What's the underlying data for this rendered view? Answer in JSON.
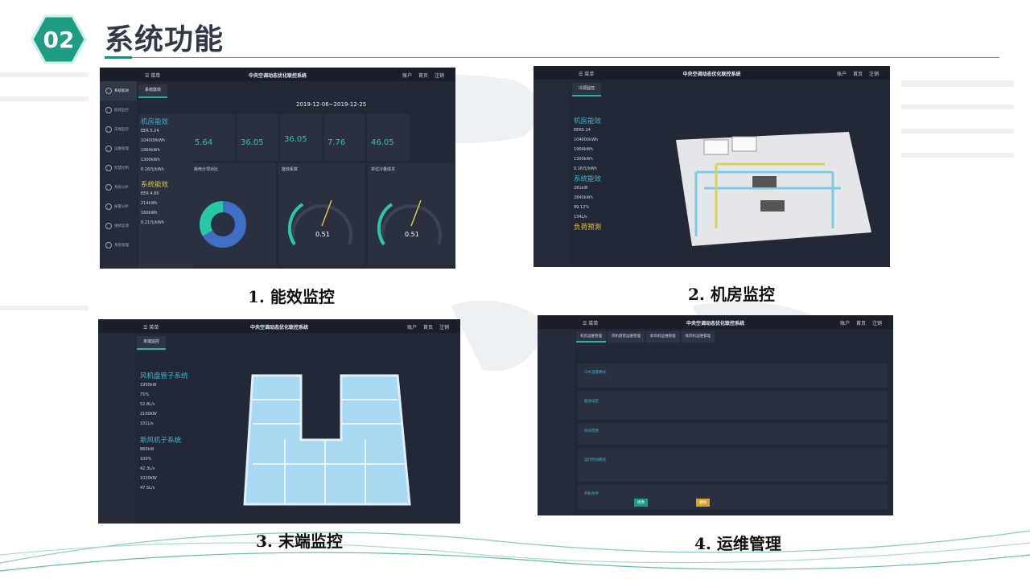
{
  "header": {
    "badge": "02",
    "title": "系统功能"
  },
  "app": {
    "title": "中央空调动态优化联控系统",
    "menu": "菜单",
    "account": "账户",
    "home": "首页",
    "logout": "注销"
  },
  "panels": [
    {
      "caption": "1. 能效监控",
      "tab": "系统能效",
      "date": "2019-12-06~2019-12-25",
      "section1": "机房能效",
      "section2": "系统能效",
      "kpis": [
        {
          "value": "5.64"
        },
        {
          "value": "36.05"
        },
        {
          "value": "36.05"
        },
        {
          "value": "7.76"
        },
        {
          "value": "46.05"
        }
      ],
      "gauges": [
        {
          "label": "能效系数",
          "value": "0.51"
        },
        {
          "label": "单位冷量成本",
          "value": "0.51"
        }
      ],
      "donut_label": "耗电分项对比"
    },
    {
      "caption": "2. 机房监控",
      "tab": "冷源监控",
      "section1": "机房能效",
      "section2": "系统能效",
      "section3": "负荷预测"
    },
    {
      "caption": "3. 末端监控",
      "tab": "末端监控",
      "section1": "风机盘管子系统",
      "section2": "新风机子系统"
    },
    {
      "caption": "4. 运维管理",
      "tabs": [
        "机房运维管理",
        "风机盘管运维管理",
        "新风机运维管理",
        "排风机运维管理"
      ],
      "rows": [
        "冷水温度模式",
        "能效设定",
        "时间范围",
        "运行时间模式",
        "开机条件"
      ],
      "buttons": [
        "修改",
        "删除"
      ]
    }
  ],
  "sidebar": [
    "系统能效",
    "能耗监控",
    "末端监控",
    "运维管理",
    "智慧控制",
    "系统分析",
    "报警分析",
    "维修监测",
    "系统管理"
  ]
}
